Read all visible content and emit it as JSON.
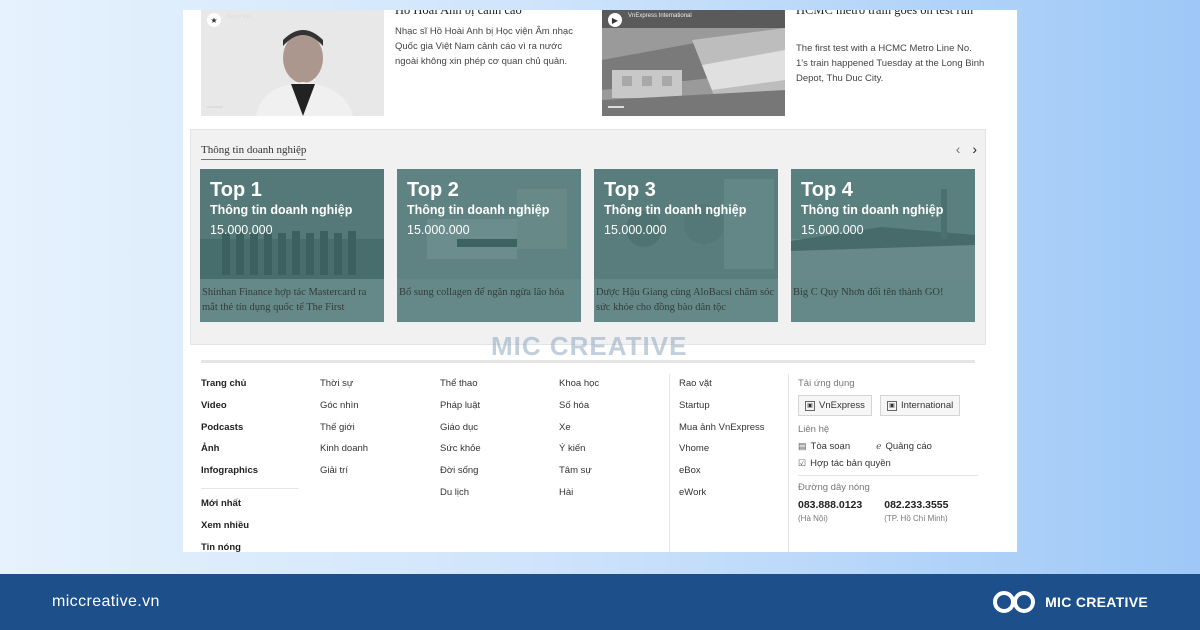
{
  "articles": [
    {
      "title": "Hồ Hoài Anh bị cảnh cáo",
      "desc": "Nhạc sĩ Hồ Hoài Anh bị Học viện Âm nhạc Quốc gia Việt Nam cảnh cáo vì ra nước ngoài không xin phép cơ quan chủ quản.",
      "thumb_caption": "Người Việt"
    },
    {
      "title": "HCMC metro train goes on test run",
      "desc": "The first test with a HCMC Metro Line No. 1's train happened Tuesday at the Long Binh Depot, Thu Duc City.",
      "thumb_caption": "VnExpress International"
    }
  ],
  "business": {
    "title": "Thông tin doanh nghiệp",
    "prev": "‹",
    "next": "›",
    "cards": [
      {
        "rank": "Top 1",
        "label": "Thông tin doanh nghiệp",
        "price": "15.000.000",
        "caption": "Shinhan Finance hợp tác Mastercard ra mắt thẻ tín dụng quốc tế The First"
      },
      {
        "rank": "Top 2",
        "label": "Thông tin doanh nghiệp",
        "price": "15.000.000",
        "caption": "Bổ sung collagen để ngăn ngừa lão hóa"
      },
      {
        "rank": "Top 3",
        "label": "Thông tin doanh nghiệp",
        "price": "15.000.000",
        "caption": "Dược Hậu Giang cùng AloBacsi chăm sóc sức khỏe cho đồng bào dân tộc"
      },
      {
        "rank": "Top 4",
        "label": "Thông tin doanh nghiệp",
        "price": "15.000.000",
        "caption": "Big C Quy Nhơn đổi tên thành GO!"
      }
    ]
  },
  "watermark": "MIC CREATIVE",
  "footer": {
    "col1": [
      "Trang chủ",
      "Video",
      "Podcasts",
      "Ảnh",
      "Infographics"
    ],
    "col1b": [
      "Mới nhất",
      "Xem nhiều",
      "Tin nóng"
    ],
    "col2": [
      "Thời sự",
      "Góc nhìn",
      "Thế giới",
      "Kinh doanh",
      "Giải trí"
    ],
    "col3": [
      "Thể thao",
      "Pháp luật",
      "Giáo dục",
      "Sức khỏe",
      "Đời sống",
      "Du lịch"
    ],
    "col4": [
      "Khoa học",
      "Số hóa",
      "Xe",
      "Ý kiến",
      "Tâm sự",
      "Hài"
    ],
    "col5": [
      "Rao vặt",
      "Startup",
      "Mua ảnh VnExpress",
      "Vhome",
      "eBox",
      "eWork"
    ],
    "app_label": "Tải ứng dụng",
    "app_buttons": [
      "VnExpress",
      "International"
    ],
    "contact_label": "Liên hệ",
    "contact_items": [
      "Tòa soạn",
      "Quảng cáo",
      "Hợp tác bản quyền"
    ],
    "hotline_label": "Đường dây nóng",
    "hotlines": [
      {
        "number": "083.888.0123",
        "city": "(Hà Nội)"
      },
      {
        "number": "082.233.3555",
        "city": "(TP. Hồ Chí Minh)"
      }
    ]
  },
  "bottom_bar": {
    "url": "miccreative.vn",
    "brand": "MIC CREATIVE",
    "color": "#1d4f8b"
  }
}
